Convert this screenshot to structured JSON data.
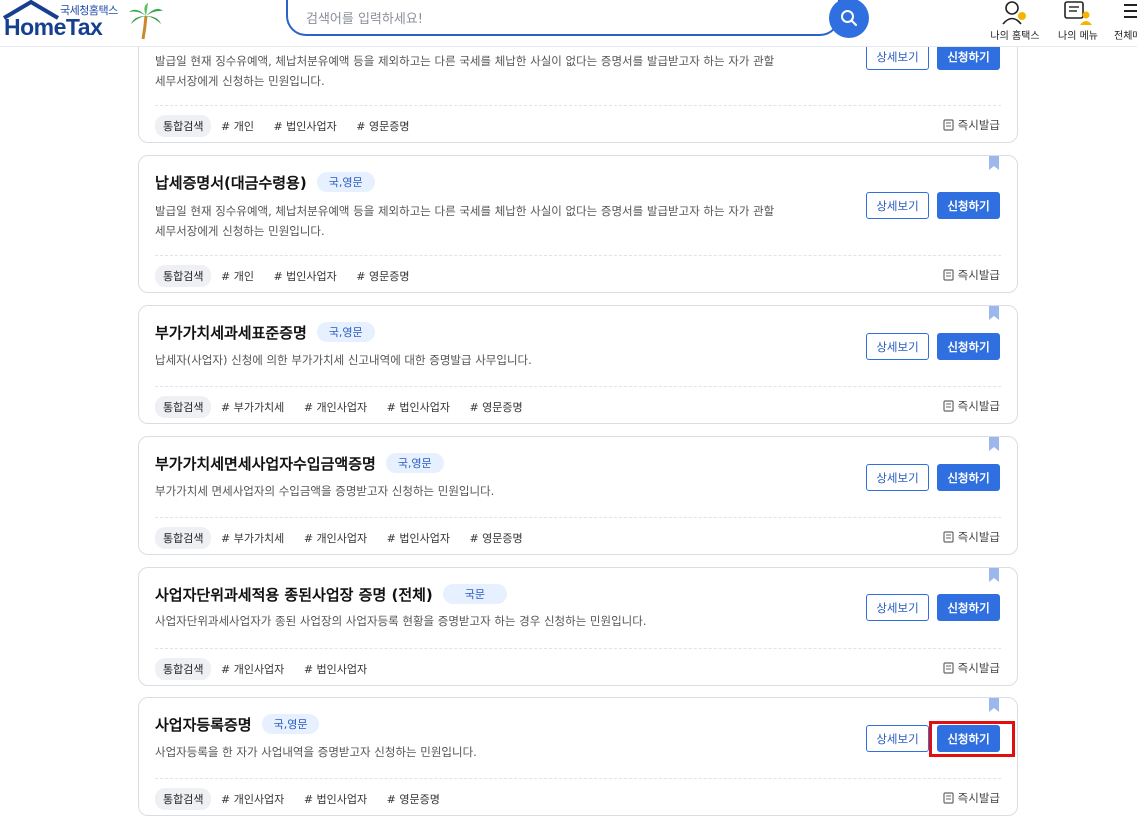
{
  "header": {
    "logo_sub": "국세청홈택스",
    "logo_main": "HomeTax",
    "search_placeholder": "검색어를 입력하세요!",
    "my_hometax": "나의 홈택스",
    "my_menu": "나의 메뉴",
    "all_menu": "전체메"
  },
  "buttons": {
    "detail": "상세보기",
    "apply": "신청하기"
  },
  "instant_label": "즉시발급",
  "cards": [
    {
      "title": "",
      "badge": "",
      "desc_line1": "발급일 현재 징수유예액, 체납처분유예액 등을 제외하고는 다른 국세를 체납한 사실이 없다는 증명서를 발급받고자 하는 자가 관할",
      "desc_line2": "세무서장에게 신청하는 민원입니다.",
      "tag_main": "통합검색",
      "tags": [
        "# 개인",
        "# 법인사업자",
        "# 영문증명"
      ]
    },
    {
      "title": "납세증명서(대금수령용)",
      "badge": "국,영문",
      "desc_line1": "발급일 현재 징수유예액, 체납처분유예액 등을 제외하고는 다른 국세를 체납한 사실이 없다는 증명서를 발급받고자 하는 자가 관할",
      "desc_line2": "세무서장에게 신청하는 민원입니다.",
      "tag_main": "통합검색",
      "tags": [
        "# 개인",
        "# 법인사업자",
        "# 영문증명"
      ]
    },
    {
      "title": "부가가치세과세표준증명",
      "badge": "국,영문",
      "desc_line1": "납세자(사업자) 신청에 의한 부가가치세 신고내역에 대한 증명발급 사무입니다.",
      "tag_main": "통합검색",
      "tags": [
        "# 부가가치세",
        "# 개인사업자",
        "# 법인사업자",
        "# 영문증명"
      ]
    },
    {
      "title": "부가가치세면세사업자수입금액증명",
      "badge": "국,영문",
      "desc_line1": "부가가치세 면세사업자의 수입금액을 증명받고자 신청하는 민원입니다.",
      "tag_main": "통합검색",
      "tags": [
        "# 부가가치세",
        "# 개인사업자",
        "# 법인사업자",
        "# 영문증명"
      ]
    },
    {
      "title": "사업자단위과세적용 종된사업장 증명 (전체)",
      "badge": "국문",
      "desc_line1": "사업자단위과세사업자가 종된 사업장의 사업자등록 현황을 증명받고자 하는 경우 신청하는 민원입니다.",
      "tag_main": "통합검색",
      "tags": [
        "# 개인사업자",
        "# 법인사업자"
      ]
    },
    {
      "title": "사업자등록증명",
      "badge": "국,영문",
      "desc_line1": "사업자등록을 한 자가 사업내역을 증명받고자 신청하는 민원입니다.",
      "tag_main": "통합검색",
      "tags": [
        "# 개인사업자",
        "# 법인사업자",
        "# 영문증명"
      ]
    }
  ],
  "colors": {
    "accent": "#2f6fe0",
    "badge_bg": "#e6f0ff",
    "highlight": "#e01010"
  }
}
